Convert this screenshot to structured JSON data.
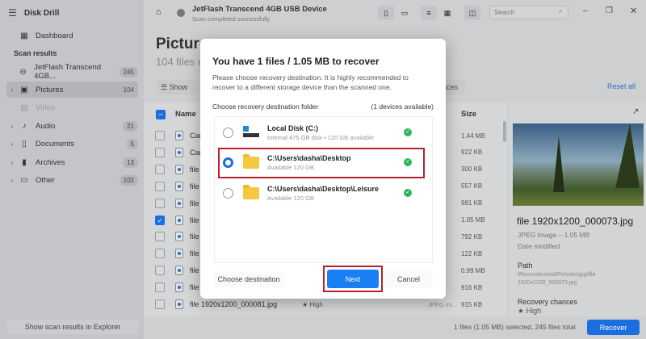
{
  "app": {
    "title": "Disk Drill"
  },
  "sidebar": {
    "dashboard": "Dashboard",
    "section": "Scan results",
    "items": [
      {
        "label": "JetFlash Transcend 4GB...",
        "count": "245",
        "icon": "drive-icon"
      },
      {
        "label": "Pictures",
        "count": "104",
        "icon": "image-icon"
      },
      {
        "label": "Video",
        "count": "",
        "icon": "video-icon"
      },
      {
        "label": "Audio",
        "count": "21",
        "icon": "music-icon"
      },
      {
        "label": "Documents",
        "count": "5",
        "icon": "document-icon"
      },
      {
        "label": "Archives",
        "count": "13",
        "icon": "archive-icon"
      },
      {
        "label": "Other",
        "count": "102",
        "icon": "other-icon"
      }
    ],
    "explorer_button": "Show scan results in Explorer"
  },
  "header": {
    "device": "JetFlash Transcend 4GB USB Device",
    "status": "Scan completed successfully",
    "search_placeholder": "Search"
  },
  "main": {
    "title": "Pictures",
    "subtitle": "104 files o",
    "show": "Show",
    "chances_chip": "nces",
    "reset_all": "Reset all",
    "columns": {
      "name": "Name",
      "size": "Size"
    },
    "rows": [
      {
        "name": "Car",
        "size": "1.44 MB",
        "checked": false
      },
      {
        "name": "Car",
        "size": "922 KB",
        "checked": false
      },
      {
        "name": "file",
        "size": "300 KB",
        "checked": false
      },
      {
        "name": "file",
        "size": "557 KB",
        "checked": false
      },
      {
        "name": "file",
        "size": "981 KB",
        "checked": false
      },
      {
        "name": "file",
        "size": "1.05 MB",
        "checked": true
      },
      {
        "name": "file",
        "size": "792 KB",
        "checked": false
      },
      {
        "name": "file",
        "size": "122 KB",
        "checked": false
      },
      {
        "name": "file",
        "size": "0.99 MB",
        "checked": false
      },
      {
        "name": "file",
        "size": "916 KB",
        "checked": false
      },
      {
        "name": "file 1920x1200_000081.jpg",
        "size": "915 KB",
        "checked": false,
        "chance": "High",
        "type": "JPEG Im..."
      }
    ]
  },
  "preview": {
    "filename": "file 1920x1200_000073.jpg",
    "type": "JPEG Image – 1.05 MB",
    "date_label": "Date modified",
    "path_label": "Path",
    "path": "\\Reconstructed\\Pictures\\jpg\\file 1920x1200_000073.jpg",
    "chances_label": "Recovery chances",
    "chances": "High"
  },
  "footer": {
    "summary": "1 files (1.05 MB) selected, 245 files total",
    "recover": "Recover"
  },
  "dialog": {
    "title": "You have 1 files / 1.05 MB to recover",
    "desc": "Please choose recovery destination. It is highly recommended to recover to a different storage device than the scanned one.",
    "section": "Choose recovery destination folder",
    "devices": "(1 devices available)",
    "destinations": [
      {
        "title": "Local Disk (C:)",
        "sub": "Internal 475 GB disk • 120 GB available",
        "selected": false
      },
      {
        "title": "C:\\Users\\dasha\\Desktop",
        "sub": "Available 120 GB",
        "selected": true
      },
      {
        "title": "C:\\Users\\dasha\\Desktop\\Leisure",
        "sub": "Available 120 GB",
        "selected": false
      }
    ],
    "choose": "Choose destination",
    "next": "Next",
    "cancel": "Cancel"
  },
  "colors": {
    "accent": "#1a6fe0",
    "highlight": "#b5202a",
    "success": "#2db55d"
  }
}
